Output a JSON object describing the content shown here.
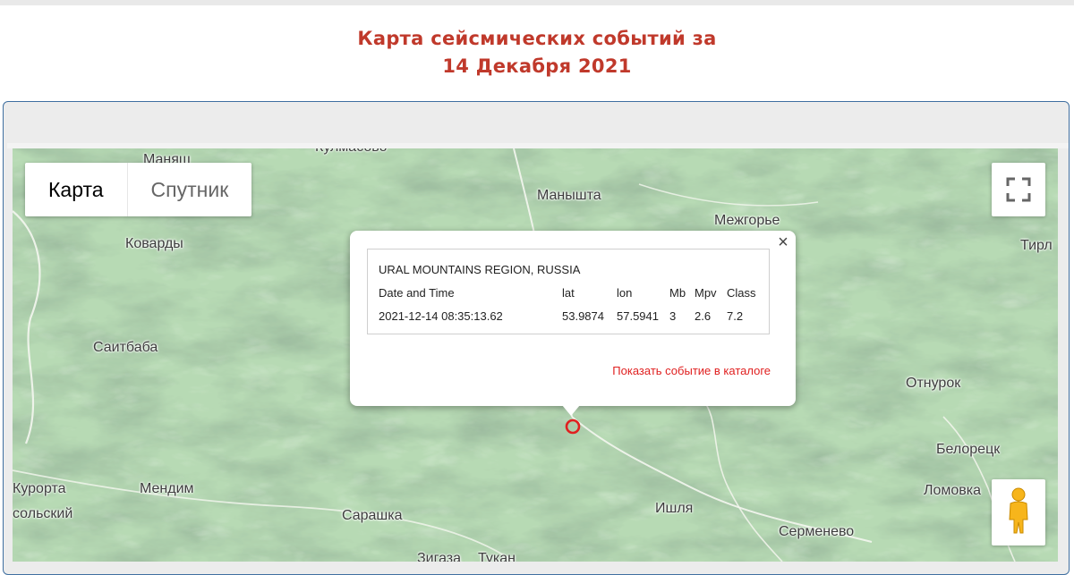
{
  "page": {
    "title_line1": "Карта сейсмических событий за",
    "title_line2": "14 Декабря 2021"
  },
  "map": {
    "map_type_buttons": [
      "Карта",
      "Спутник"
    ],
    "selected_map_type": "Карта",
    "places": [
      {
        "name": "Кулмасово"
      },
      {
        "name": "Манышта"
      },
      {
        "name": "Межгорье"
      },
      {
        "name": "Тирл"
      },
      {
        "name": "Коварды"
      },
      {
        "name": "Саитбаба"
      },
      {
        "name": "Отнурок"
      },
      {
        "name": "Белорецк"
      },
      {
        "name": "Курорта"
      },
      {
        "name": "сольский"
      },
      {
        "name": "Мендим"
      },
      {
        "name": "Сарашка"
      },
      {
        "name": "Ишля"
      },
      {
        "name": "Ломовка"
      },
      {
        "name": "Серменево"
      },
      {
        "name": "Зигаза"
      },
      {
        "name": "Тукан"
      },
      {
        "name": "Маняш"
      }
    ],
    "controls": {
      "fullscreen": "fullscreen-icon",
      "street_view": "pegman-icon"
    },
    "marker_color": "#e02020"
  },
  "popup": {
    "region": "URAL MOUNTAINS REGION, RUSSIA",
    "headers": {
      "datetime": "Date and Time",
      "lat": "lat",
      "lon": "lon",
      "mb": "Mb",
      "mpv": "Mpv",
      "class": "Class"
    },
    "event": {
      "datetime": "2021-12-14 08:35:13.62",
      "lat": "53.9874",
      "lon": "57.5941",
      "mb": "3",
      "mpv": "2.6",
      "class": "7.2"
    },
    "link": "Показать событие в каталоге",
    "close": "×"
  },
  "colors": {
    "title": "#c0392b",
    "frame_border": "#3f6fa0",
    "terrain": "#b9dcb6",
    "link": "#e02020"
  }
}
